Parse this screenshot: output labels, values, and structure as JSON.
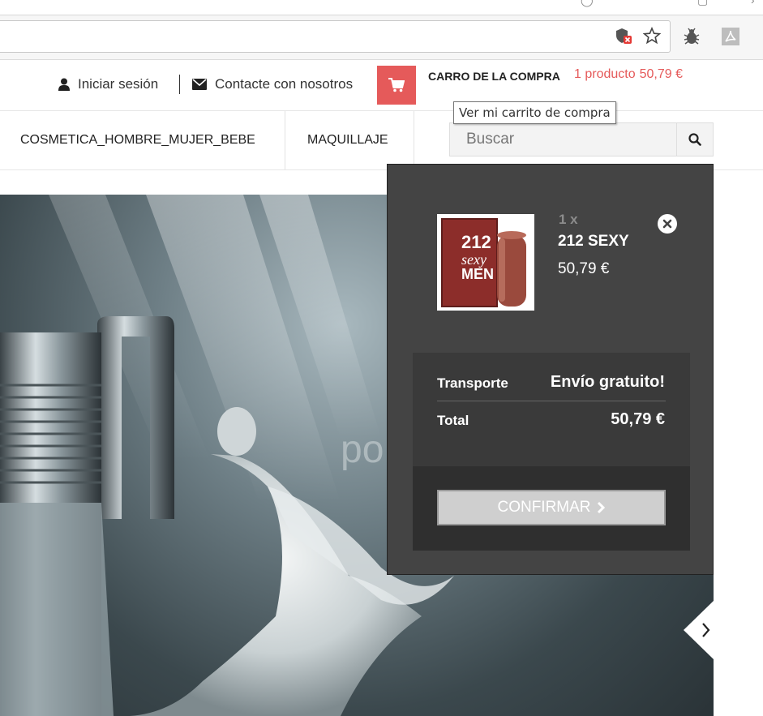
{
  "browser": {
    "url_text": "",
    "icons": [
      "shield-blocked-icon",
      "star-icon",
      "bug-extension-icon",
      "pdf-extension-icon"
    ]
  },
  "header": {
    "login_label": "Iniciar sesión",
    "contact_label": "Contacte con nosotros",
    "cart_title": "CARRO DE LA COMPRA",
    "cart_count": "1 producto",
    "cart_amount": "50,79 €",
    "accent_color": "#e55a5a"
  },
  "tooltip": {
    "text": "Ver mi carrito de compra"
  },
  "nav": {
    "items": [
      {
        "label": "COSMETICA_HOMBRE_MUJER_BEBE"
      },
      {
        "label": "MAQUILLAJE"
      }
    ],
    "search_placeholder": "Buscar"
  },
  "cart_dropdown": {
    "product": {
      "quantity": "1 x",
      "name": "212 SEXY",
      "price": "50,79 €",
      "image_text": [
        "212",
        "sexy",
        "MEN"
      ]
    },
    "shipping_label": "Transporte",
    "shipping_value": "Envío gratuito!",
    "total_label": "Total",
    "total_value": "50,79 €",
    "confirm_label": "CONFIRMAR"
  },
  "hero": {
    "brand_fragment": "po"
  }
}
